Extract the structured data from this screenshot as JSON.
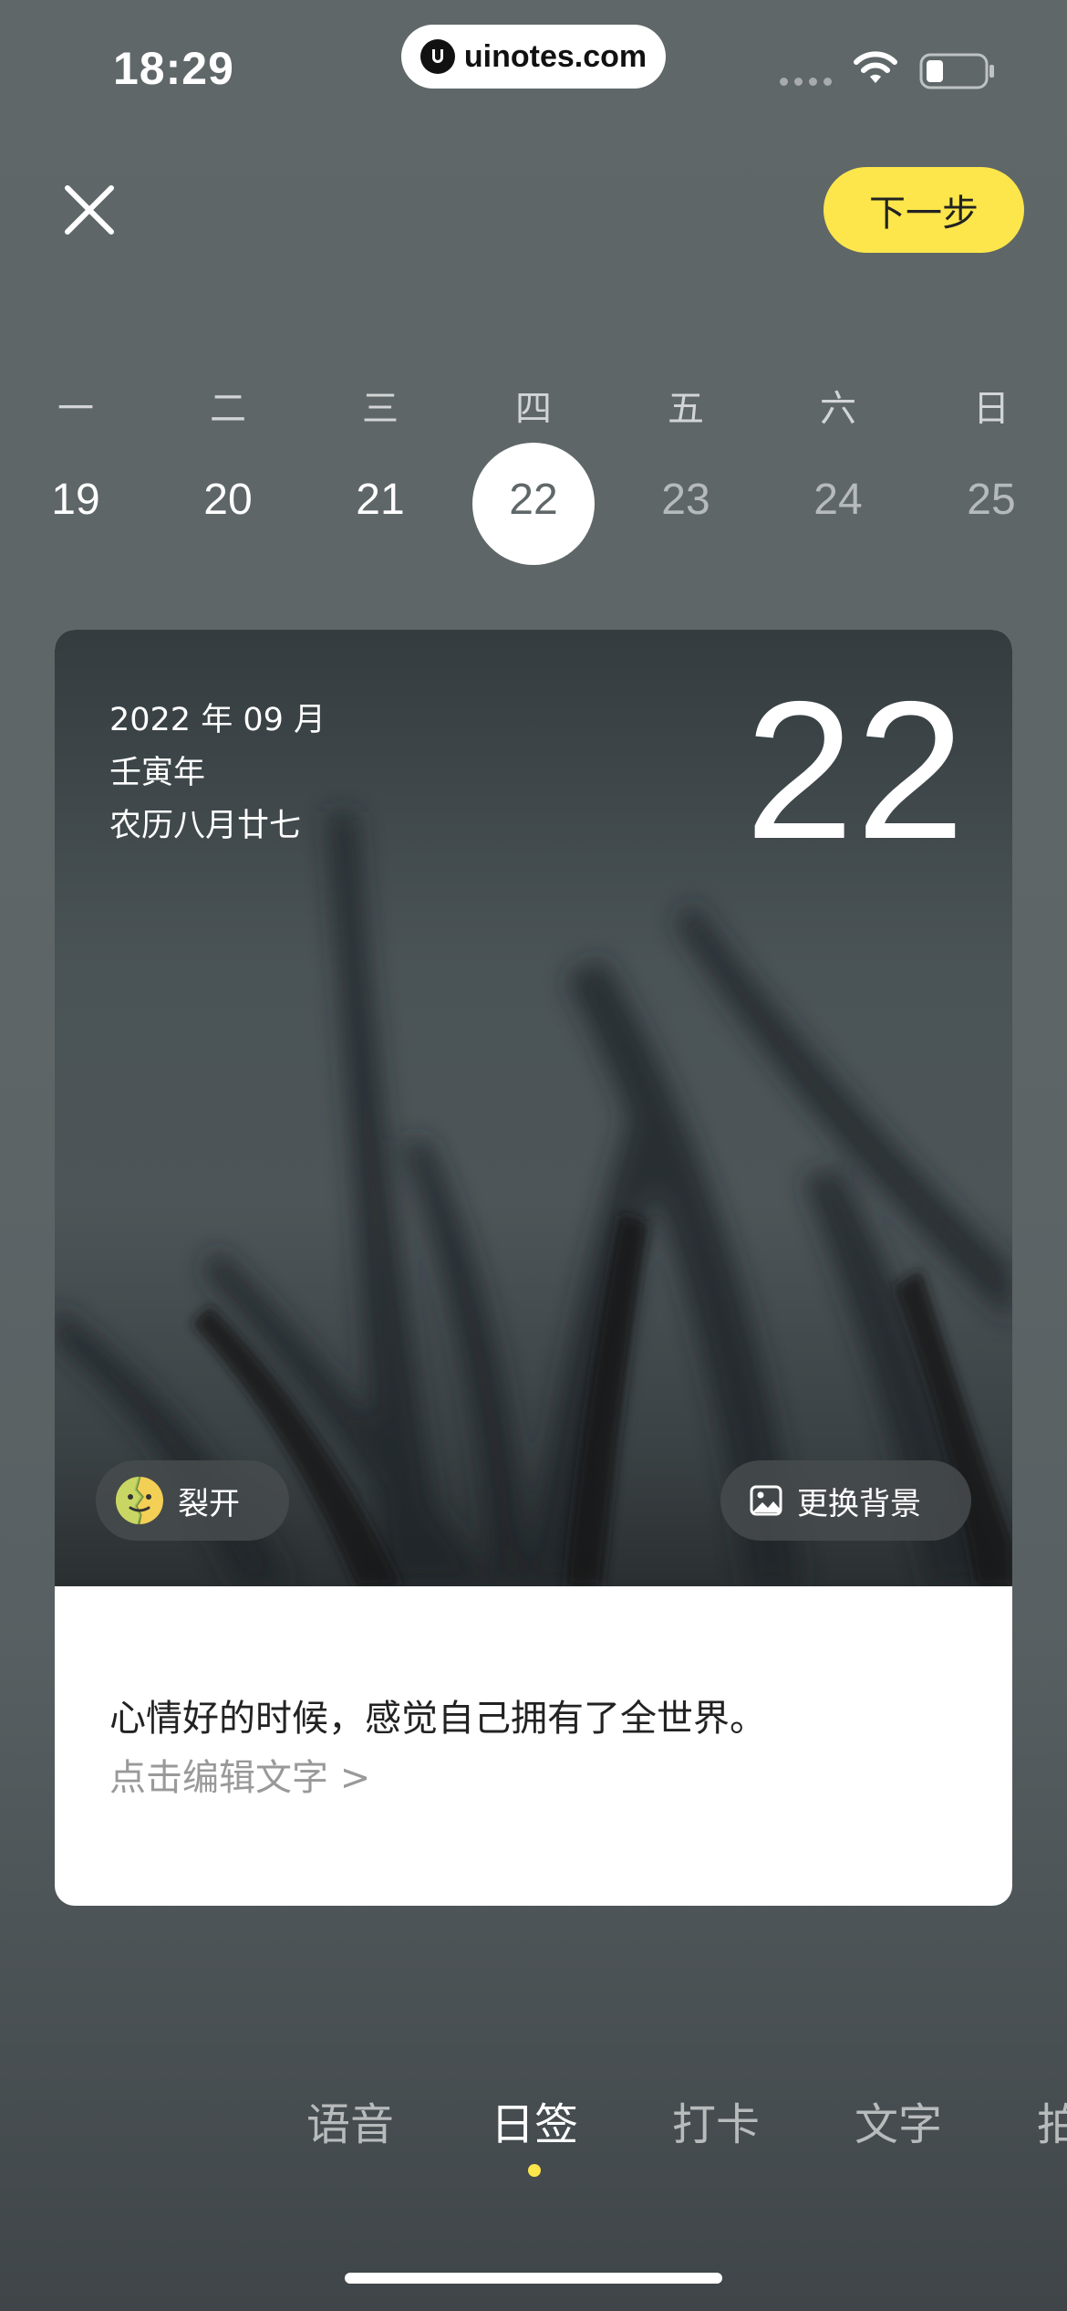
{
  "status_bar": {
    "time": "18:29",
    "url": "uinotes.com"
  },
  "header": {
    "close_icon": "close-icon",
    "next_label": "下一步",
    "accent_color": "#fce64b"
  },
  "week": {
    "weekdays": [
      "一",
      "二",
      "三",
      "四",
      "五",
      "六",
      "日"
    ],
    "days": [
      "19",
      "20",
      "21",
      "22",
      "23",
      "24",
      "25"
    ],
    "selected_index": 3
  },
  "card": {
    "year_month": "2022 年 09 月",
    "ganzhi_year": "壬寅年",
    "lunar_date": "农历八月廿七",
    "day": "22",
    "mood_label": "裂开",
    "mood_icon": "cracked-face-icon",
    "change_bg_label": "更换背景",
    "change_bg_icon": "image-icon",
    "quote": "心情好的时候，感觉自己拥有了全世界。",
    "edit_hint": "点击编辑文字 >"
  },
  "tabs": {
    "items": [
      "语音",
      "日签",
      "打卡",
      "文字",
      "拍"
    ],
    "active_index": 1
  }
}
